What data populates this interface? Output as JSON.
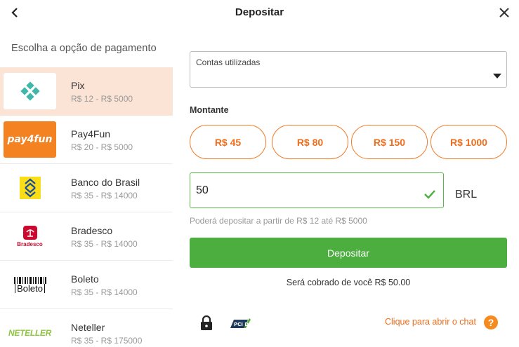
{
  "header": {
    "title": "Depositar"
  },
  "left": {
    "title": "Escolha a opção de pagamento",
    "methods": [
      {
        "name": "Pix",
        "range": "R$ 12 - R$ 5000",
        "selected": true,
        "icon": "pix-logo"
      },
      {
        "name": "Pay4Fun",
        "range": "R$ 20 - R$ 5000",
        "selected": false,
        "icon": "pay4fun-logo",
        "logo_text": "pay4fun"
      },
      {
        "name": "Banco do Brasil",
        "range": "R$ 35 - R$ 14000",
        "selected": false,
        "icon": "banco-do-brasil-logo",
        "logo_text": "Banco do Brasil"
      },
      {
        "name": "Bradesco",
        "range": "R$ 35 - R$ 14000",
        "selected": false,
        "icon": "bradesco-logo",
        "logo_text": "Bradesco"
      },
      {
        "name": "Boleto",
        "range": "R$ 35 - R$ 14000",
        "selected": false,
        "icon": "boleto-logo",
        "logo_text": "Boleto"
      },
      {
        "name": "Neteller",
        "range": "R$ 35 - R$ 175000",
        "selected": false,
        "icon": "neteller-logo",
        "logo_text": "NETELLER"
      }
    ]
  },
  "form": {
    "accounts_label": "Contas utilizadas",
    "amount_label": "Montante",
    "presets": [
      "R$ 45",
      "R$ 80",
      "R$ 150",
      "R$ 1000"
    ],
    "amount_value": "50",
    "currency": "BRL",
    "hint": "Poderá depositar a partir de R$ 12 até R$ 5000",
    "deposit_label": "Depositar",
    "charge_text": "Será cobrado de você R$ 50.00"
  },
  "footer": {
    "chat_link": "Clique para abrir o chat",
    "pci_text": "PCI DSS"
  },
  "colors": {
    "accent_orange": "#ee6c1b",
    "selected_bg": "#fbe3d5",
    "success_green": "#4cae3f"
  }
}
